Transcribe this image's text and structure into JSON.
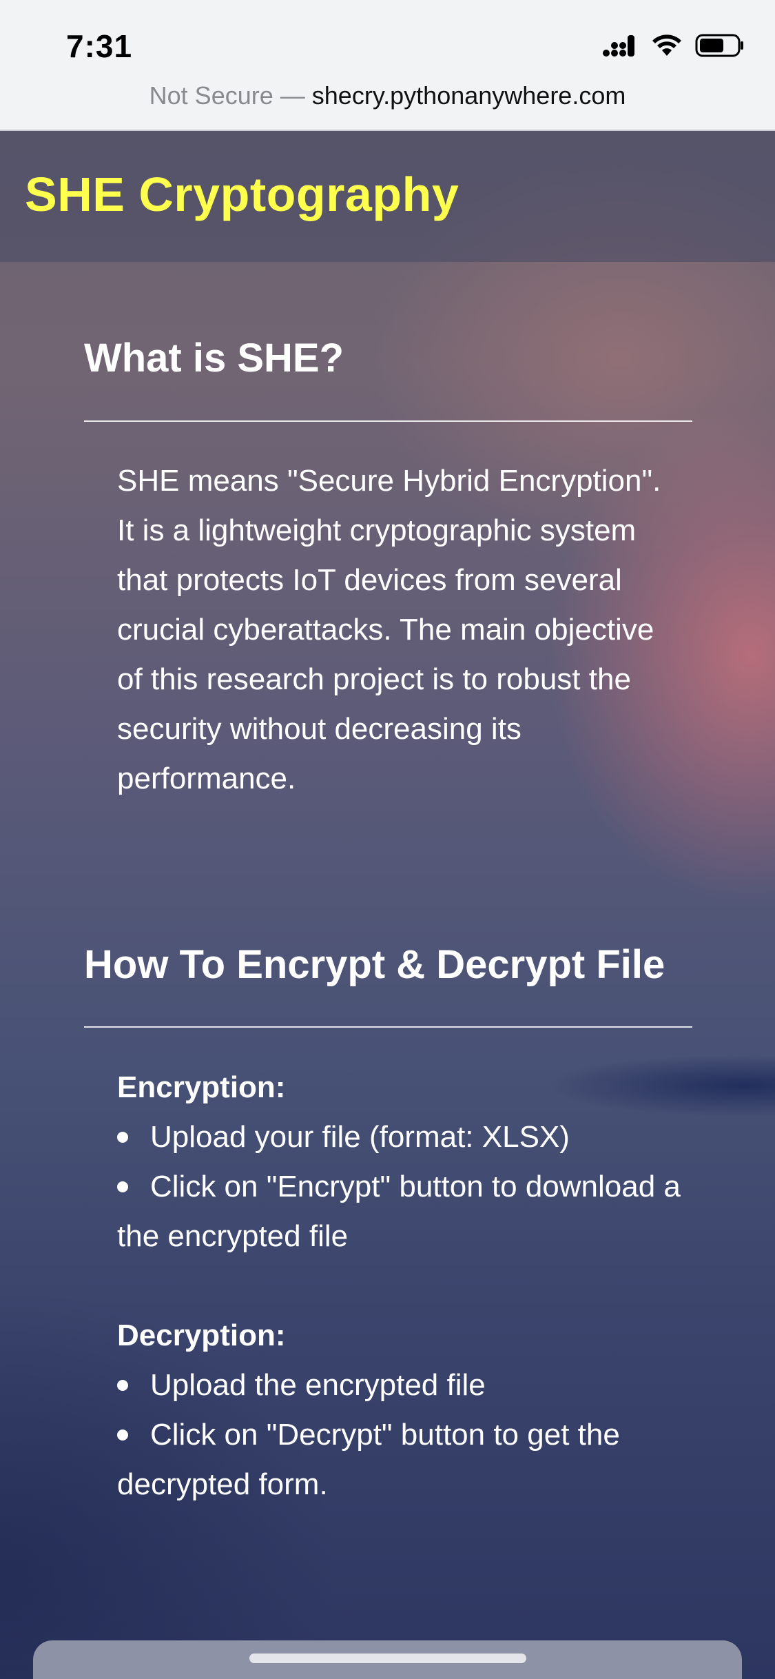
{
  "status_bar": {
    "time": "7:31"
  },
  "url_bar": {
    "prefix": "Not Secure",
    "separator": "—",
    "domain": "shecry.pythonanywhere.com"
  },
  "header": {
    "title": "SHE Cryptography",
    "title_color": "#ffff4d"
  },
  "about": {
    "heading": "What is SHE?",
    "body": "SHE means \"Secure Hybrid Encryption\". It is a lightweight cryptographic system that protects IoT devices from several crucial cyberattacks. The main objective of this research project is to robust the security without decreasing its performance."
  },
  "howto": {
    "heading": "How To Encrypt & Decrypt File",
    "encryption": {
      "title": "Encryption:",
      "steps": [
        "Upload your file (format: XLSX)",
        "Click on \"Encrypt\" button to download a the encrypted file"
      ]
    },
    "decryption": {
      "title": "Decryption:",
      "steps": [
        "Upload the encrypted file",
        "Click on \"Decrypt\" button to get the decrypted form."
      ]
    }
  },
  "icons": {
    "signal": "cellular-signal-icon",
    "wifi": "wifi-icon",
    "battery": "battery-icon"
  }
}
